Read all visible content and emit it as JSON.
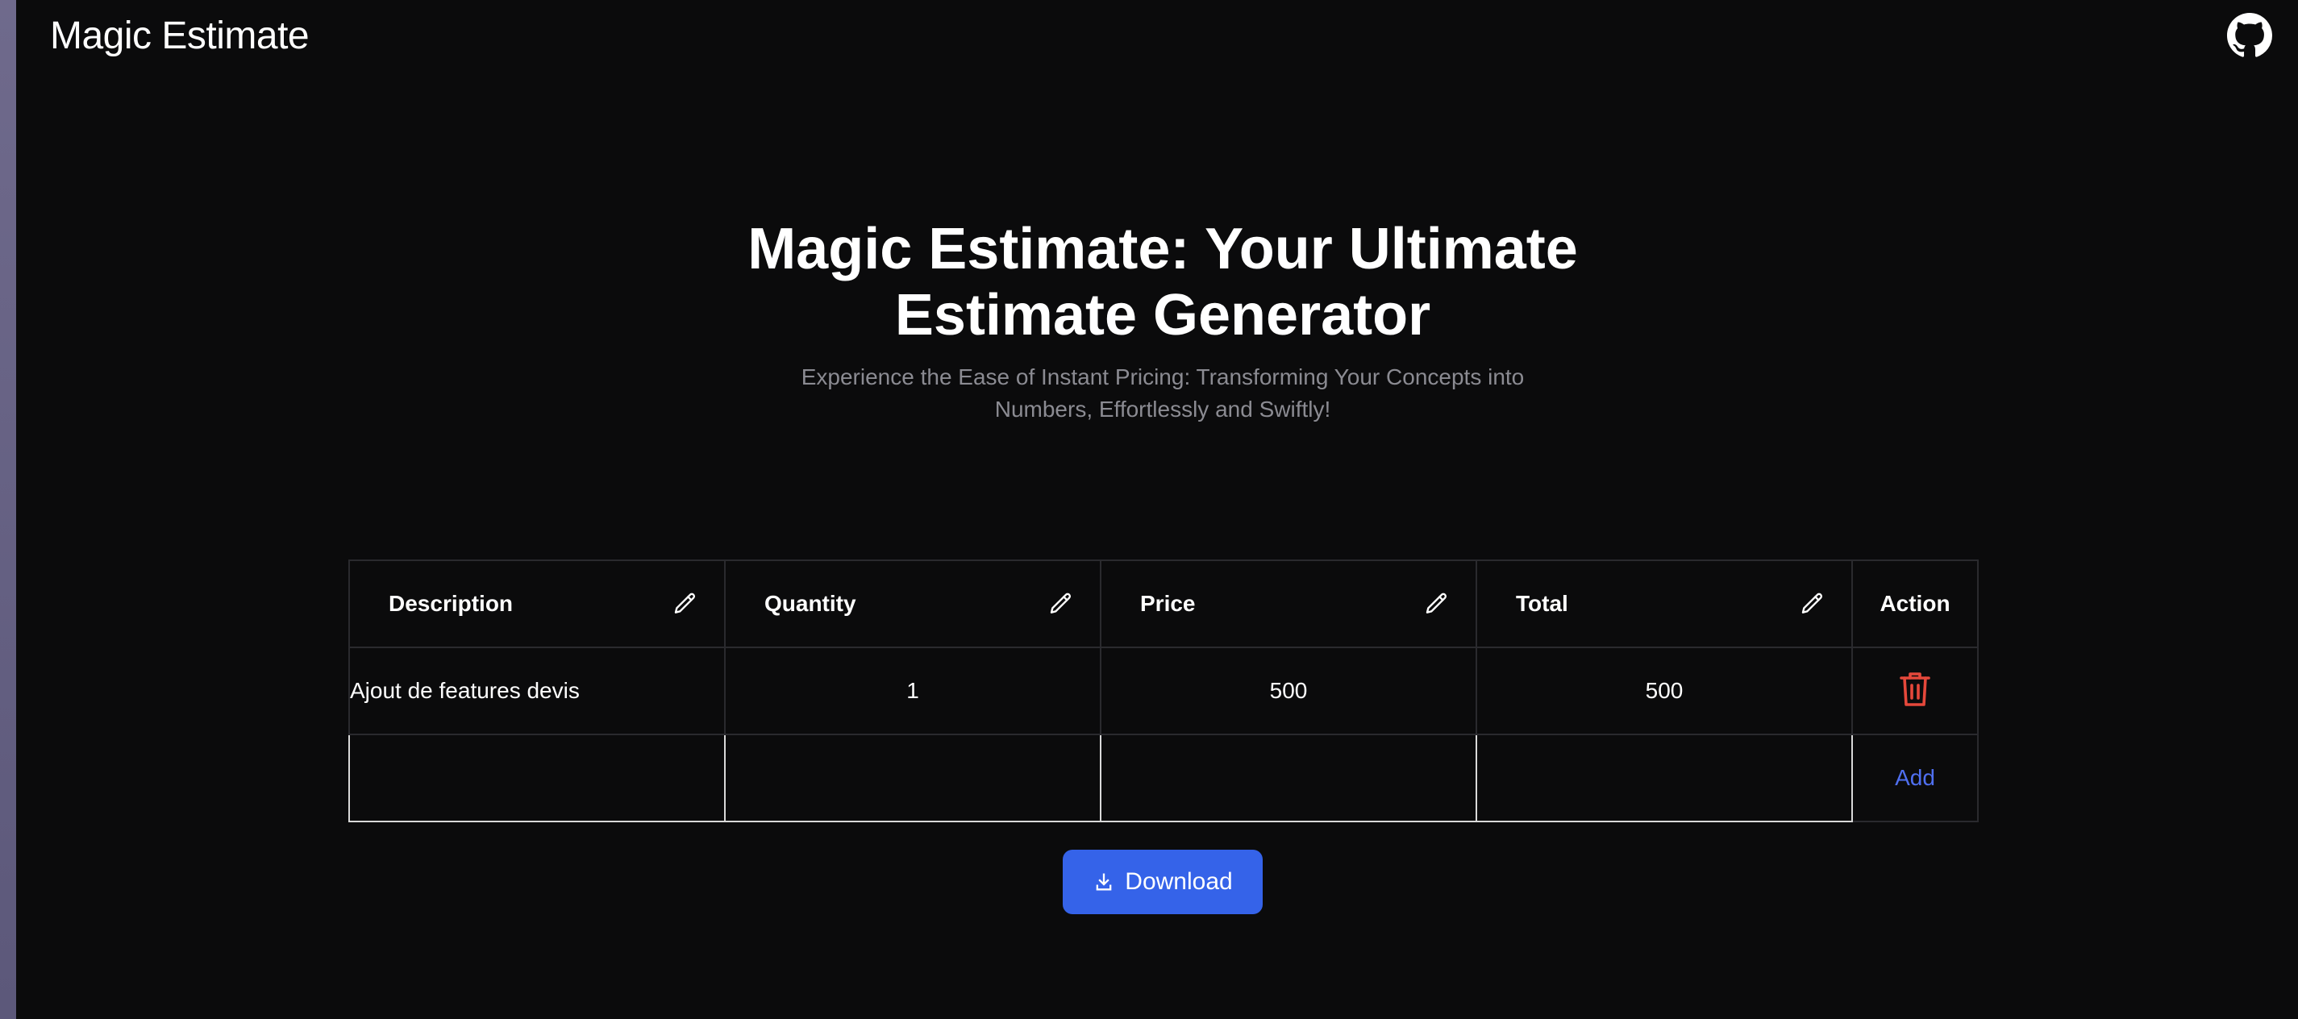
{
  "header": {
    "brand": "Magic Estimate",
    "github_icon": "github-icon"
  },
  "hero": {
    "title": "Magic Estimate: Your Ultimate Estimate Generator",
    "subtitle": "Experience the Ease of Instant Pricing: Transforming Your Concepts into Numbers, Effortlessly and Swiftly!"
  },
  "table": {
    "columns": {
      "description": "Description",
      "quantity": "Quantity",
      "price": "Price",
      "total": "Total",
      "action": "Action"
    },
    "rows": [
      {
        "description": "Ajout de features devis",
        "quantity": "1",
        "price": "500",
        "total": "500"
      }
    ],
    "new_row": {
      "description": "",
      "quantity": "",
      "price": "",
      "total": "",
      "add_label": "Add"
    }
  },
  "download": {
    "label": "Download",
    "icon": "download-icon"
  },
  "colors": {
    "background": "#0b0b0c",
    "accent": "#3563e9",
    "link": "#4f6ff0",
    "danger": "#e5483b",
    "muted_text": "#8b8b92"
  }
}
